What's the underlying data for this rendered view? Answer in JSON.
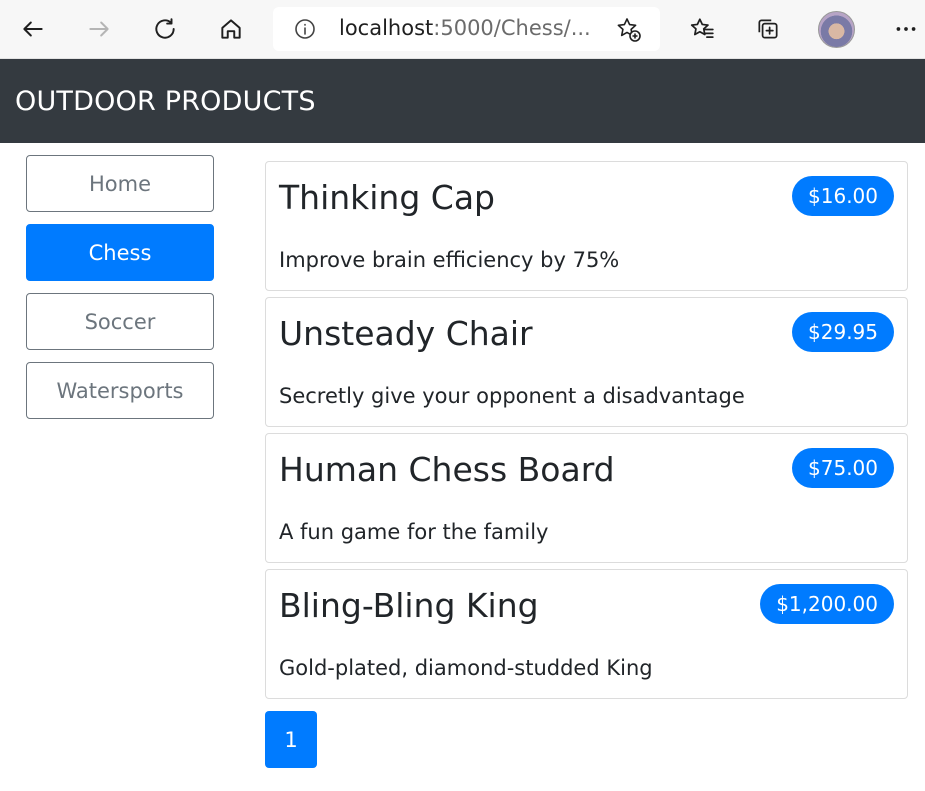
{
  "browser": {
    "url_host": "localhost",
    "url_rest": ":5000/Chess/...",
    "icons": [
      "back-arrow-icon",
      "forward-arrow-icon",
      "refresh-icon",
      "home-icon",
      "info-icon",
      "add-favorite-icon",
      "favorites-icon",
      "collections-icon",
      "profile-avatar",
      "more-icon"
    ]
  },
  "header": {
    "title": "OUTDOOR PRODUCTS"
  },
  "categories": [
    {
      "label": "Home",
      "active": false
    },
    {
      "label": "Chess",
      "active": true
    },
    {
      "label": "Soccer",
      "active": false
    },
    {
      "label": "Watersports",
      "active": false
    }
  ],
  "products": [
    {
      "name": "Thinking Cap",
      "price": "$16.00",
      "description": "Improve brain efficiency by 75%"
    },
    {
      "name": "Unsteady Chair",
      "price": "$29.95",
      "description": "Secretly give your opponent a disadvantage"
    },
    {
      "name": "Human Chess Board",
      "price": "$75.00",
      "description": "A fun game for the family"
    },
    {
      "name": "Bling-Bling King",
      "price": "$1,200.00",
      "description": "Gold-plated, diamond-studded King"
    }
  ],
  "pagination": {
    "pages": [
      "1"
    ],
    "current": "1"
  },
  "colors": {
    "primary": "#007bff",
    "header_bg": "#343a40",
    "secondary": "#6c757d"
  }
}
